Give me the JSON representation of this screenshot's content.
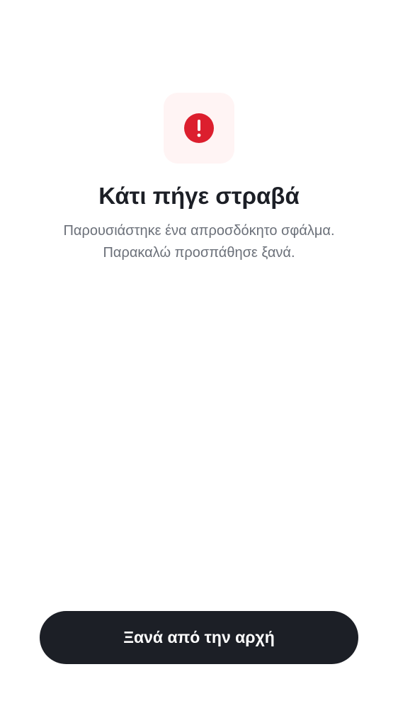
{
  "error": {
    "icon": "exclamation-circle-icon",
    "icon_color": "#dc1f2e",
    "icon_tile_color": "#fff4f4",
    "title": "Κάτι πήγε στραβά",
    "message_line_1": "Παρουσιάστηκε ένα απροσδόκητο σφάλμα.",
    "message_line_2": "Παρακαλώ προσπάθησε ξανά."
  },
  "actions": {
    "restart_label": "Ξανά από την αρχή",
    "button_color": "#1c1f26"
  }
}
